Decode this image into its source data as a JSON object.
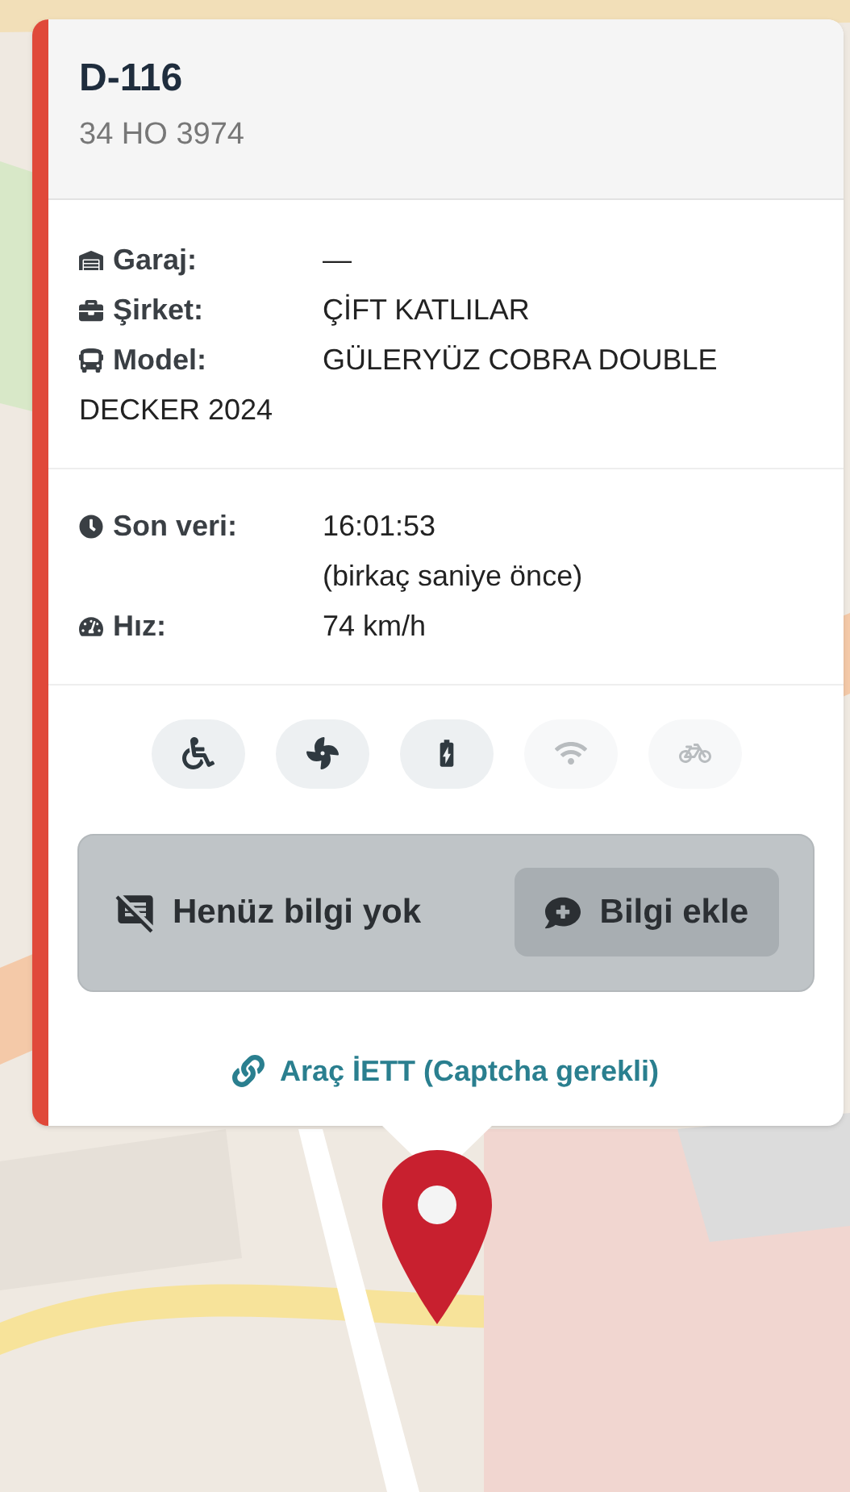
{
  "popup": {
    "title": "D-116",
    "plate": "34 HO 3974",
    "details": [
      {
        "kind": "garage",
        "label": "Garaj:",
        "value": "—"
      },
      {
        "kind": "company",
        "label": "Şirket:",
        "value": "ÇİFT KATLILAR"
      },
      {
        "kind": "model",
        "label": "Model:",
        "value": "GÜLERYÜZ COBRA DOUBLE",
        "continuation": "DECKER 2024"
      }
    ],
    "status": [
      {
        "kind": "time",
        "label": "Son veri:",
        "value": "16:01:53",
        "note": "(birkaç saniye önce)"
      },
      {
        "kind": "speed",
        "label": "Hız:",
        "value": "74 km/h"
      }
    ],
    "features": [
      {
        "kind": "wheelchair",
        "on": true
      },
      {
        "kind": "ac",
        "on": true
      },
      {
        "kind": "charging",
        "on": true
      },
      {
        "kind": "wifi",
        "on": false
      },
      {
        "kind": "bike",
        "on": false
      }
    ],
    "info": {
      "empty_text": "Henüz bilgi yok",
      "add_button": "Bilgi ekle"
    },
    "link": "Araç İETT (Captcha gerekli)"
  }
}
